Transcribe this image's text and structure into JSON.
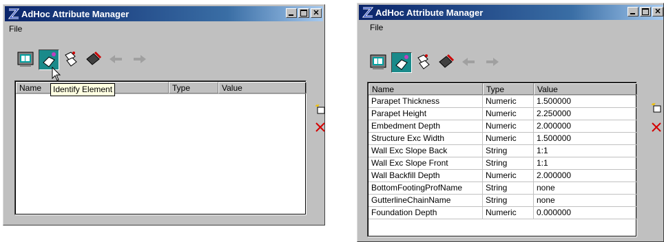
{
  "left_window": {
    "title": "AdHoc Attribute Manager",
    "menu": [
      "File"
    ],
    "tooltip": "Identify Element",
    "columns": [
      "Name",
      "Type",
      "Value"
    ],
    "rows": []
  },
  "right_window": {
    "title": "AdHoc Attribute Manager",
    "menu": [
      "File"
    ],
    "columns": [
      "Name",
      "Type",
      "Value"
    ],
    "rows": [
      {
        "name": "Parapet Thickness",
        "type": "Numeric",
        "value": "1.500000"
      },
      {
        "name": "Parapet Height",
        "type": "Numeric",
        "value": "2.250000"
      },
      {
        "name": "Embedment Depth",
        "type": "Numeric",
        "value": "2.000000"
      },
      {
        "name": "Structure Exc Width",
        "type": "Numeric",
        "value": "1.500000"
      },
      {
        "name": "Wall Exc Slope Back",
        "type": "String",
        "value": "1:1"
      },
      {
        "name": "Wall Exc Slope Front",
        "type": "String",
        "value": "1:1"
      },
      {
        "name": "Wall Backfill Depth",
        "type": "Numeric",
        "value": "2.000000"
      },
      {
        "name": "BottomFootingProfName",
        "type": "String",
        "value": "none"
      },
      {
        "name": "GutterlineChainName",
        "type": "String",
        "value": "none"
      },
      {
        "name": "Foundation Depth",
        "type": "Numeric",
        "value": "0.000000"
      }
    ]
  },
  "toolbar_icons": [
    "monitor-icon",
    "identify-element-icon",
    "tags-icon",
    "delete-tag-icon",
    "arrow-left-icon",
    "arrow-right-icon"
  ],
  "side_icons": [
    "new-attribute-icon",
    "delete-x-icon"
  ],
  "colors": {
    "title_start": "#0a246a",
    "title_end": "#a6caf0",
    "window_bg": "#c0c0c0",
    "pressed_tool": "#1a8a8a",
    "delete_red": "#d40000"
  }
}
